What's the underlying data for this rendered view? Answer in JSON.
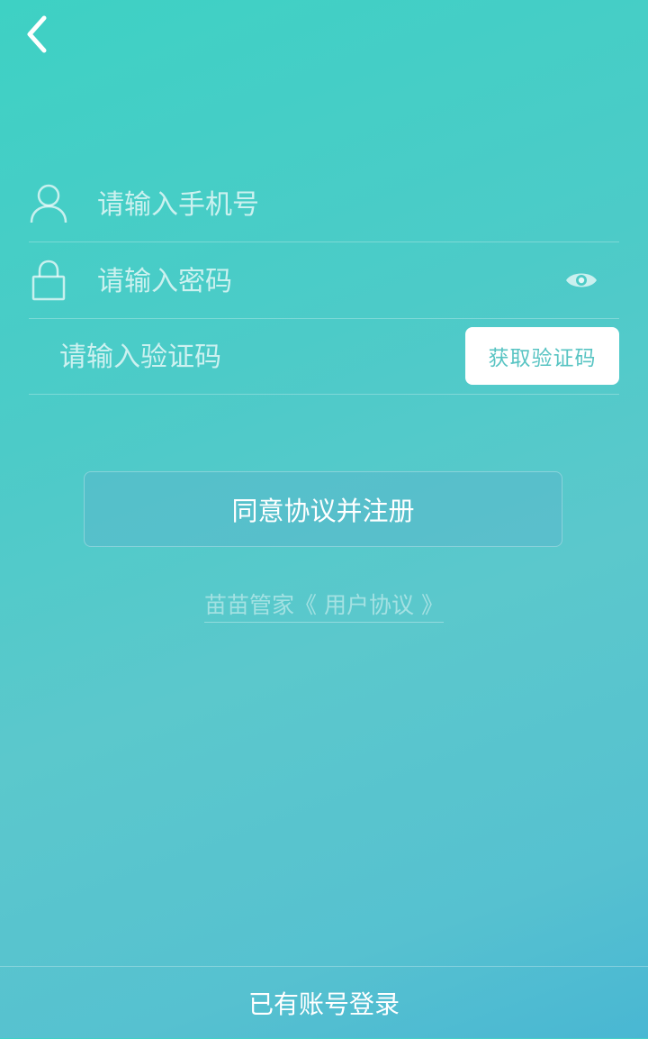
{
  "nav": {
    "back_icon": "chevron-left-icon"
  },
  "form": {
    "phone": {
      "icon": "user-icon",
      "placeholder": "请输入手机号",
      "value": ""
    },
    "password": {
      "icon": "lock-icon",
      "placeholder": "请输入密码",
      "value": "",
      "toggle_icon": "eye-icon"
    },
    "code": {
      "placeholder": "请输入验证码",
      "value": "",
      "button_label": "获取验证码"
    }
  },
  "register_button_label": "同意协议并注册",
  "agreement_link": "苗苗管家《 用户协议 》",
  "footer": {
    "login_label": "已有账号登录"
  },
  "colors": {
    "gradient_start": "#3ed1c4",
    "gradient_end": "#49b7d3",
    "button_text": "#58c4c3"
  }
}
